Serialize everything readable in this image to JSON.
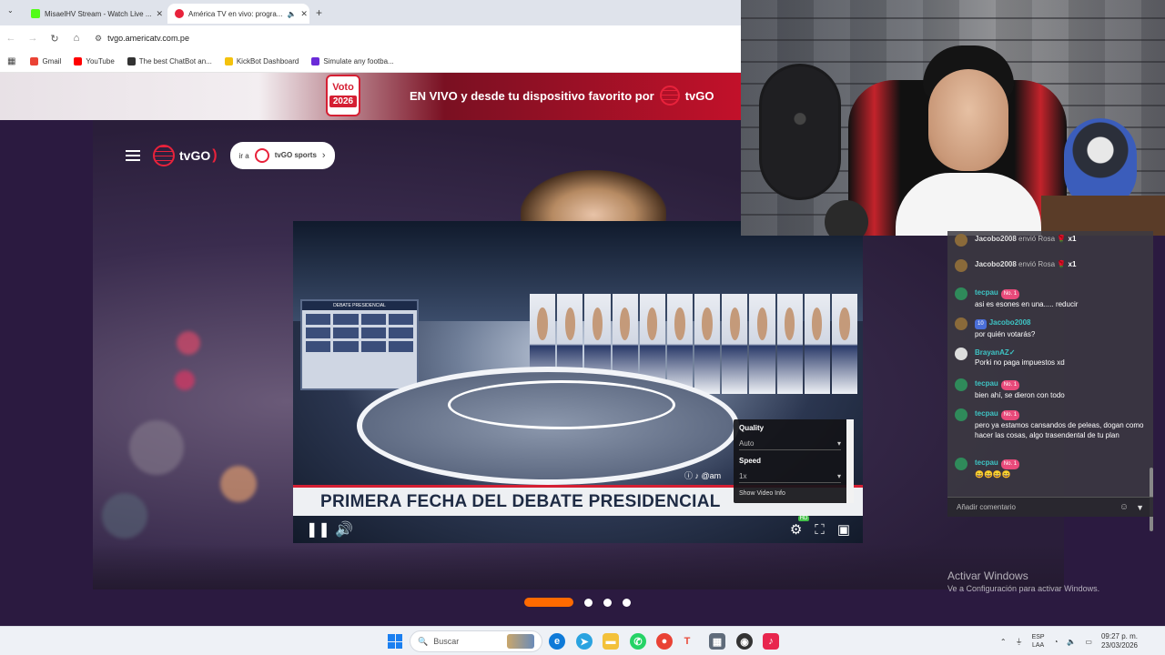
{
  "browser": {
    "tabs": [
      {
        "title": "MisaelHV Stream - Watch Live ...",
        "active": false
      },
      {
        "title": "América TV en vivo: progra...",
        "active": true
      }
    ],
    "address": "tvgo.americatv.com.pe",
    "bookmarks": [
      "Gmail",
      "YouTube",
      "The best ChatBot an...",
      "KickBot Dashboard",
      "Simulate any footba..."
    ]
  },
  "banner": {
    "badge_top": "Voto",
    "badge_year": "2026",
    "headline": "EN VIVO y desde tu dispositivo favorito por",
    "brand": "tvGO"
  },
  "site_nav": {
    "logo": "tvGO",
    "link_prefix": "ir a",
    "link_brand": "tvGO sports"
  },
  "player": {
    "lower_third": "PRIMERA FECHA DEL DEBATE PRESIDENCIAL",
    "handle": "@am",
    "settings": {
      "quality_label": "Quality",
      "quality_value": "Auto",
      "speed_label": "Speed",
      "speed_value": "1x",
      "info_link": "Show Video Info"
    }
  },
  "carousel": {
    "count": 4,
    "active": 0
  },
  "chat": {
    "messages": [
      {
        "user": "Jacobo2008",
        "text": "envió Rosa",
        "gift": "x1",
        "type": "gift"
      },
      {
        "user": "Jacobo2008",
        "text": "envió Rosa",
        "gift": "x1",
        "type": "gift"
      },
      {
        "user": "tecpau",
        "badge": "No. 1",
        "text": "asi es esones en una..... reducir",
        "type": "msg"
      },
      {
        "user": "Jacobo2008",
        "level": "10",
        "text": "por quién votarás?",
        "type": "msg"
      },
      {
        "user": "BrayanAZ✓",
        "text": "Porki no paga impuestos xd",
        "type": "msg"
      },
      {
        "user": "tecpau",
        "badge": "No. 1",
        "text": "bien ahí, se dieron con todo",
        "type": "msg"
      },
      {
        "user": "tecpau",
        "badge": "No. 1",
        "text": "pero ya estamos cansandos de peleas, dogan como hacer las cosas, algo trasendental de tu plan",
        "type": "msg"
      },
      {
        "user": "tecpau",
        "badge": "No. 1",
        "text": "😄😄😄😄",
        "type": "msg"
      }
    ],
    "input_placeholder": "Añadir comentario"
  },
  "watermark": {
    "title": "Activar Windows",
    "subtitle": "Ve a Configuración para activar Windows."
  },
  "taskbar": {
    "search_placeholder": "Buscar",
    "lang_top": "ESP",
    "lang_bottom": "LAA",
    "time": "09:27 p. m.",
    "date": "23/03/2026"
  },
  "colors": {
    "brand_red": "#e8223b",
    "carousel_active": "#ff6a00",
    "chat_username": "#3ec4c4"
  }
}
